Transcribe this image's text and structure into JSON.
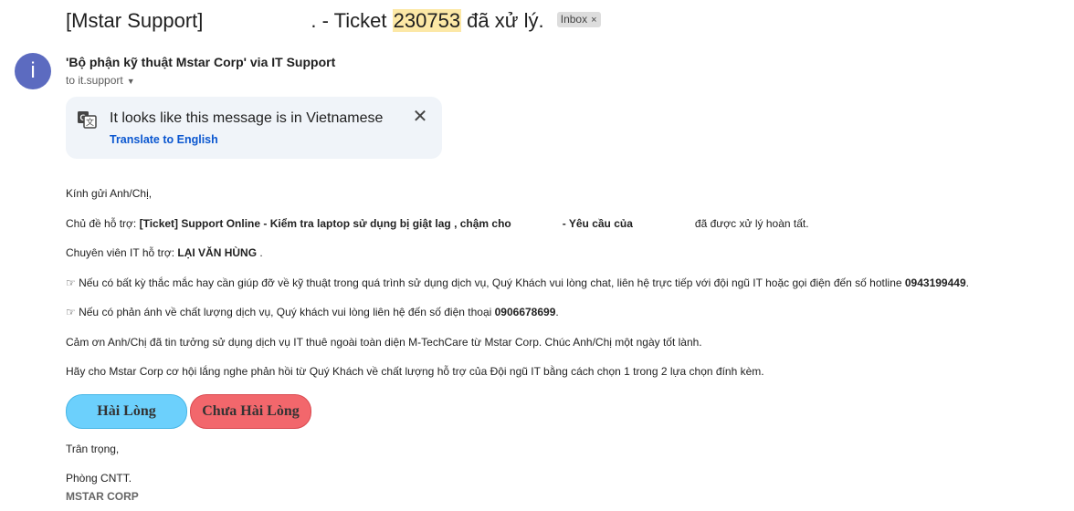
{
  "subject": {
    "prefix": "[Mstar Support]",
    "middle": ". - Ticket ",
    "ticket_number": "230753",
    "suffix": " đã xử lý.",
    "label_chip": "Inbox",
    "label_chip_close": "×"
  },
  "sender": {
    "avatar_letter": "i",
    "name": "'Bộ phận kỹ thuật Mstar Corp' via IT Support",
    "recipient": "to it.support"
  },
  "translate": {
    "message": "It looks like this message is in Vietnamese",
    "link": "Translate to English"
  },
  "body": {
    "greeting": "Kính gửi Anh/Chị,",
    "topic_label": "Chủ đề hỗ trợ: ",
    "topic_bold": "[Ticket] Support Online - Kiểm tra laptop sử dụng bị giật lag , chậm cho",
    "topic_request": "- Yêu cầu của",
    "topic_end": "đã được xử lý hoàn tất.",
    "specialist_label": "Chuyên viên IT hỗ trợ: ",
    "specialist_name": "LẠI VĂN HÙNG",
    "specialist_end": " .",
    "hotline_text": "☞ Nếu có bất kỳ thắc mắc hay cần giúp đỡ về kỹ thuật trong quá trình sử dụng dịch vụ, Quý Khách vui lòng chat, liên hệ trực tiếp với đội ngũ IT hoặc gọi điện đến số hotline ",
    "hotline_number": "0943199449",
    "hotline_end": ".",
    "feedback_text": "☞ Nếu có phản ánh về chất lượng dịch vụ, Quý khách vui lòng liên hệ đến số điện thoại ",
    "feedback_number": "0906678699",
    "feedback_end": ".",
    "thanks": "Cảm ơn Anh/Chị đã tin tưởng sử dụng dịch vụ IT thuê ngoài toàn diện M-TechCare từ Mstar Corp. Chúc Anh/Chị một ngày tốt lành.",
    "survey": "Hãy cho Mstar Corp cơ hội lắng nghe phản hồi từ Quý Khách về chất lượng hỗ trợ của Đội ngũ IT bằng cách chọn 1 trong 2 lựa chọn đính kèm.",
    "btn_satisfied": "Hài Lòng",
    "btn_unsatisfied": "Chưa Hài Lòng",
    "closing": "Trân trọng,",
    "department": "Phòng CNTT.",
    "company": "MSTAR CORP"
  },
  "colors": {
    "avatar": "#5c6bc0",
    "link": "#0b57d0",
    "highlight": "#fce8a6",
    "btn_satisfied": "#6cd0fc",
    "btn_unsatisfied": "#f2676c"
  }
}
